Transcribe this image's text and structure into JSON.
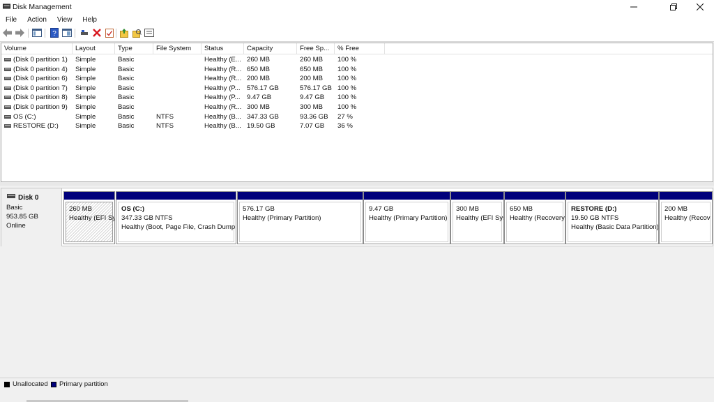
{
  "window": {
    "title": "Disk Management"
  },
  "menu": [
    "File",
    "Action",
    "View",
    "Help"
  ],
  "toolbar": {
    "icons": [
      "back-arrow-icon",
      "forward-arrow-icon",
      "console-tree-icon",
      "help-icon",
      "console-properties-icon",
      "connect-icon",
      "delete-icon",
      "checklist-icon",
      "new-folder-up-icon",
      "search-folder-icon",
      "properties-list-icon"
    ]
  },
  "volume_table": {
    "columns": [
      "Volume",
      "Layout",
      "Type",
      "File System",
      "Status",
      "Capacity",
      "Free Sp...",
      "% Free"
    ],
    "rows": [
      [
        "(Disk 0 partition 1)",
        "Simple",
        "Basic",
        "",
        "Healthy (E...",
        "260 MB",
        "260 MB",
        "100 %"
      ],
      [
        "(Disk 0 partition 4)",
        "Simple",
        "Basic",
        "",
        "Healthy (R...",
        "650 MB",
        "650 MB",
        "100 %"
      ],
      [
        "(Disk 0 partition 6)",
        "Simple",
        "Basic",
        "",
        "Healthy (R...",
        "200 MB",
        "200 MB",
        "100 %"
      ],
      [
        "(Disk 0 partition 7)",
        "Simple",
        "Basic",
        "",
        "Healthy (P...",
        "576.17 GB",
        "576.17 GB",
        "100 %"
      ],
      [
        "(Disk 0 partition 8)",
        "Simple",
        "Basic",
        "",
        "Healthy (P...",
        "9.47 GB",
        "9.47 GB",
        "100 %"
      ],
      [
        "(Disk 0 partition 9)",
        "Simple",
        "Basic",
        "",
        "Healthy (R...",
        "300 MB",
        "300 MB",
        "100 %"
      ],
      [
        "OS (C:)",
        "Simple",
        "Basic",
        "NTFS",
        "Healthy (B...",
        "347.33 GB",
        "93.36 GB",
        "27 %"
      ],
      [
        "RESTORE (D:)",
        "Simple",
        "Basic",
        "NTFS",
        "Healthy (B...",
        "19.50 GB",
        "7.07 GB",
        "36 %"
      ]
    ]
  },
  "disk": {
    "name": "Disk 0",
    "type": "Basic",
    "size": "953.85 GB",
    "state": "Online",
    "partitions": [
      {
        "name": "",
        "size": "260 MB",
        "status": "Healthy (EFI Sy"
      },
      {
        "name": "OS  (C:)",
        "size": "347.33 GB NTFS",
        "status": "Healthy (Boot, Page File, Crash Dump,"
      },
      {
        "name": "",
        "size": "576.17 GB",
        "status": "Healthy (Primary Partition)"
      },
      {
        "name": "",
        "size": "9.47 GB",
        "status": "Healthy (Primary Partition)"
      },
      {
        "name": "",
        "size": "300 MB",
        "status": "Healthy (EFI Sys"
      },
      {
        "name": "",
        "size": "650 MB",
        "status": "Healthy (Recovery"
      },
      {
        "name": "RESTORE  (D:)",
        "size": "19.50 GB NTFS",
        "status": "Healthy (Basic Data Partition)"
      },
      {
        "name": "",
        "size": "200 MB",
        "status": "Healthy (Recov"
      }
    ]
  },
  "legend": [
    {
      "label": "Unallocated",
      "color": "#000000"
    },
    {
      "label": "Primary partition",
      "color": "#00007b"
    }
  ]
}
